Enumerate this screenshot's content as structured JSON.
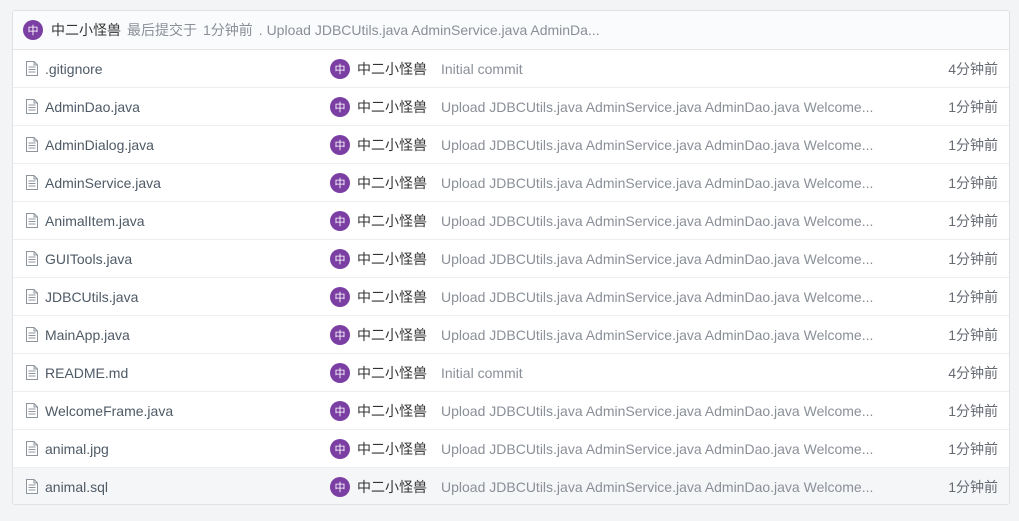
{
  "header": {
    "avatar_char": "中",
    "author": "中二小怪兽",
    "label": "最后提交于",
    "time": "1分钟前",
    "message": ". Upload JDBCUtils.java AdminService.java AdminDa..."
  },
  "files": [
    {
      "name": ".gitignore",
      "avatar_char": "中",
      "author": "中二小怪兽",
      "message": "Initial commit",
      "time": "4分钟前"
    },
    {
      "name": "AdminDao.java",
      "avatar_char": "中",
      "author": "中二小怪兽",
      "message": "Upload JDBCUtils.java AdminService.java AdminDao.java Welcome...",
      "time": "1分钟前"
    },
    {
      "name": "AdminDialog.java",
      "avatar_char": "中",
      "author": "中二小怪兽",
      "message": "Upload JDBCUtils.java AdminService.java AdminDao.java Welcome...",
      "time": "1分钟前"
    },
    {
      "name": "AdminService.java",
      "avatar_char": "中",
      "author": "中二小怪兽",
      "message": "Upload JDBCUtils.java AdminService.java AdminDao.java Welcome...",
      "time": "1分钟前"
    },
    {
      "name": "AnimalItem.java",
      "avatar_char": "中",
      "author": "中二小怪兽",
      "message": "Upload JDBCUtils.java AdminService.java AdminDao.java Welcome...",
      "time": "1分钟前"
    },
    {
      "name": "GUITools.java",
      "avatar_char": "中",
      "author": "中二小怪兽",
      "message": "Upload JDBCUtils.java AdminService.java AdminDao.java Welcome...",
      "time": "1分钟前"
    },
    {
      "name": "JDBCUtils.java",
      "avatar_char": "中",
      "author": "中二小怪兽",
      "message": "Upload JDBCUtils.java AdminService.java AdminDao.java Welcome...",
      "time": "1分钟前"
    },
    {
      "name": "MainApp.java",
      "avatar_char": "中",
      "author": "中二小怪兽",
      "message": "Upload JDBCUtils.java AdminService.java AdminDao.java Welcome...",
      "time": "1分钟前"
    },
    {
      "name": "README.md",
      "avatar_char": "中",
      "author": "中二小怪兽",
      "message": "Initial commit",
      "time": "4分钟前"
    },
    {
      "name": "WelcomeFrame.java",
      "avatar_char": "中",
      "author": "中二小怪兽",
      "message": "Upload JDBCUtils.java AdminService.java AdminDao.java Welcome...",
      "time": "1分钟前"
    },
    {
      "name": "animal.jpg",
      "avatar_char": "中",
      "author": "中二小怪兽",
      "message": "Upload JDBCUtils.java AdminService.java AdminDao.java Welcome...",
      "time": "1分钟前"
    },
    {
      "name": "animal.sql",
      "avatar_char": "中",
      "author": "中二小怪兽",
      "message": "Upload JDBCUtils.java AdminService.java AdminDao.java Welcome...",
      "time": "1分钟前"
    }
  ],
  "icons": {
    "file": "file-icon",
    "avatar_color": "#7b3ea3"
  }
}
